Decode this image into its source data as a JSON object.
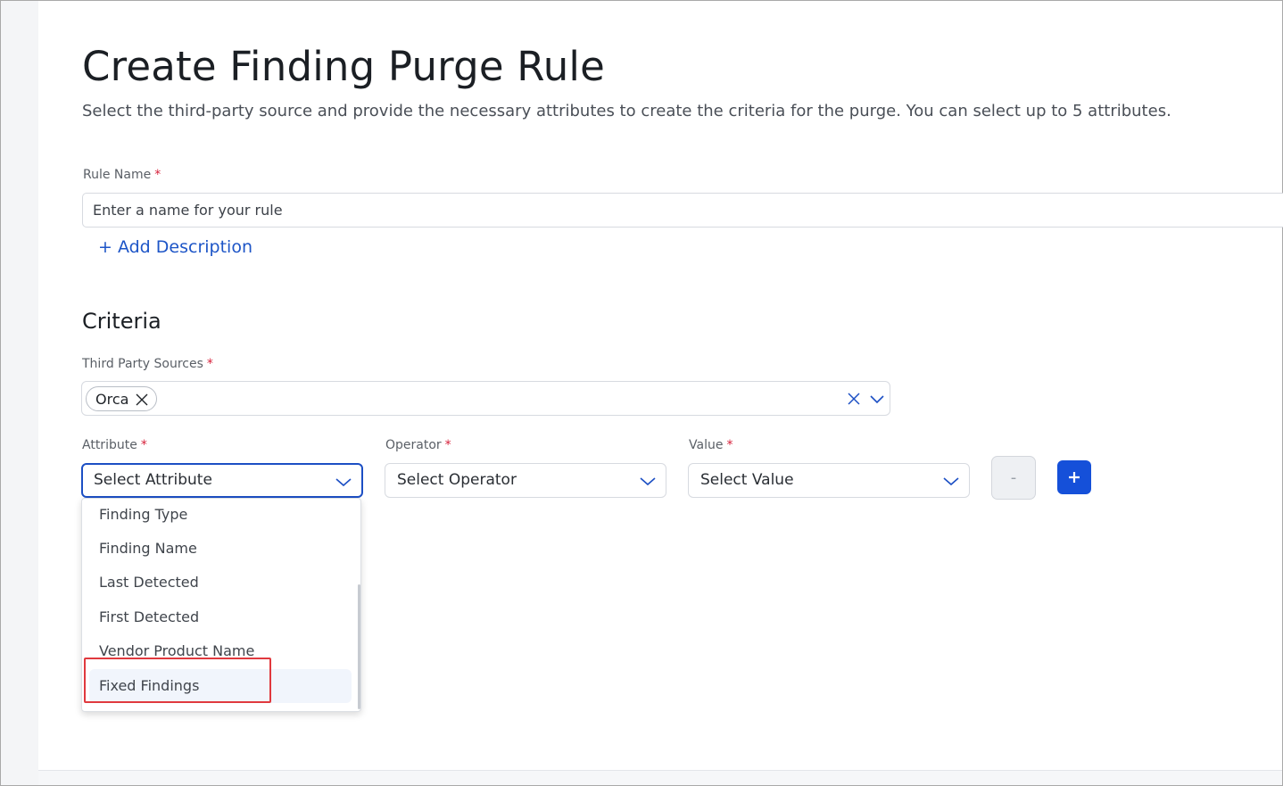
{
  "page": {
    "title": "Create Finding Purge Rule",
    "description": "Select the third-party source and provide the necessary attributes to create the criteria for the purge. You can select up to 5 attributes."
  },
  "rule_name": {
    "label": "Rule Name",
    "required_mark": "*",
    "placeholder": "Enter a name for your rule",
    "value": ""
  },
  "add_description": {
    "label": "+ Add Description"
  },
  "criteria": {
    "section_title": "Criteria",
    "third_party_sources": {
      "label": "Third Party Sources",
      "required_mark": "*",
      "selected": [
        "Orca"
      ]
    },
    "attribute": {
      "label": "Attribute",
      "required_mark": "*",
      "placeholder": "Select Attribute",
      "open": true,
      "options": [
        "Finding Type",
        "Finding Name",
        "Last Detected",
        "First Detected",
        "Vendor Product Name",
        "Fixed Findings"
      ],
      "hovered_option": "Fixed Findings"
    },
    "operator": {
      "label": "Operator",
      "required_mark": "*",
      "placeholder": "Select Operator"
    },
    "value": {
      "label": "Value",
      "required_mark": "*",
      "placeholder": "Select Value"
    },
    "remove_button": {
      "label": "-",
      "disabled": true
    },
    "add_button": {
      "label": "+"
    }
  },
  "icons": {
    "chip_remove": "close-icon",
    "clear_all": "close-icon",
    "dropdown_toggle": "chevron-down-icon",
    "add": "plus-icon"
  },
  "colors": {
    "primary": "#1550d9",
    "link": "#1d55c7",
    "required": "#d6203a",
    "focus_border": "#1c4fc4",
    "annotation_box": "#e0393e"
  }
}
